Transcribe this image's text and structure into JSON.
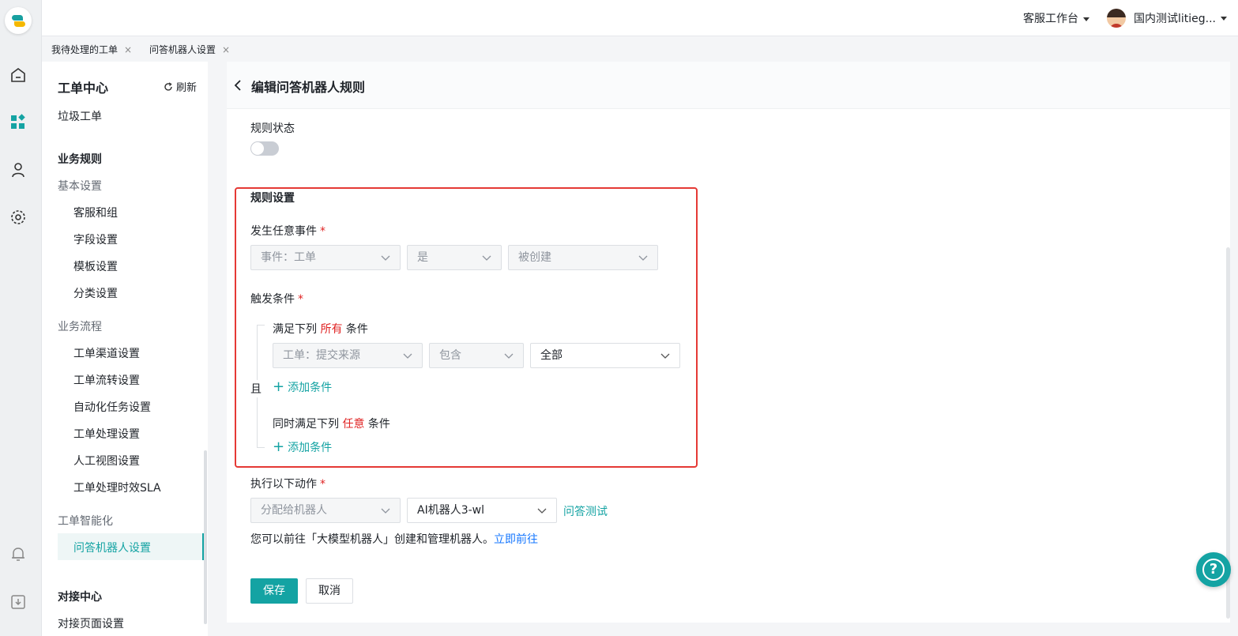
{
  "topbar": {
    "workspace": "客服工作台",
    "user_name": "国内测试litieg..."
  },
  "tabs": [
    {
      "label": "我待处理的工单",
      "close": "×"
    },
    {
      "label": "问答机器人设置",
      "close": "×"
    }
  ],
  "sidenav": {
    "title": "工单中心",
    "refresh": "刷新",
    "trash": "垃圾工单",
    "section_rules": "业务规则",
    "group_basic": "基本设置",
    "basic_items": [
      "客服和组",
      "字段设置",
      "模板设置",
      "分类设置"
    ],
    "group_flow": "业务流程",
    "flow_items": [
      "工单渠道设置",
      "工单流转设置",
      "自动化任务设置",
      "工单处理设置",
      "人工视图设置",
      "工单处理时效SLA"
    ],
    "group_ai": "工单智能化",
    "active_item": "问答机器人设置",
    "section_dock": "对接中心",
    "dock_item": "对接页面设置"
  },
  "page": {
    "title": "编辑问答机器人规则",
    "status_label": "规则状态",
    "rule_settings": "规则设置",
    "event_label": "发生任意事件",
    "event_selects": [
      "事件：工单",
      "是",
      "被创建"
    ],
    "trigger_label": "触发条件",
    "all_prefix": "满足下列",
    "all_word": "所有",
    "cond_suffix": "条件",
    "cond_selects": [
      "工单：提交来源",
      "包含",
      "全部"
    ],
    "and_label": "且",
    "add_condition": "添加条件",
    "any_prefix": "同时满足下列",
    "any_word": "任意",
    "action_label": "执行以下动作",
    "action_selects": [
      "分配给机器人",
      "AI机器人3-wl"
    ],
    "qa_test": "问答测试",
    "hint_text": "您可以前往「大模型机器人」创建和管理机器人。",
    "hint_link": "立即前往",
    "save": "保存",
    "cancel": "取消",
    "required_mark": "*"
  },
  "help_glyph": "?",
  "colors": {
    "accent": "#14a3a3",
    "highlight_border": "#e53935",
    "required": "#e02424",
    "link": "#1677ff"
  }
}
